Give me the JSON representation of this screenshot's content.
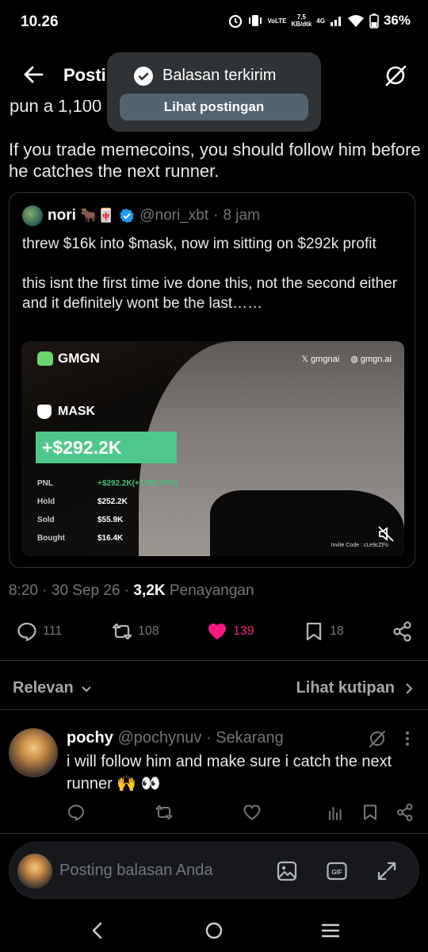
{
  "status_bar": {
    "time": "10.26",
    "volte": "VoLTE",
    "speed_value": "7,5",
    "speed_unit": "KB/dtk",
    "network": "4G",
    "battery": "36%"
  },
  "header": {
    "title": "Postingan"
  },
  "toast": {
    "message": "Balasan terkirim",
    "button_label": "Lihat postingan"
  },
  "main_tweet": {
    "text": "If you trade memecoins, you should follow him before he catches the next runner.",
    "partial_line": "pun a 1,100"
  },
  "quote": {
    "name": "nori",
    "emoji": "🐂🀄",
    "handle": "@nori_xbt",
    "time": "8 jam",
    "paragraph_1": "threw $16k into $mask, now im sitting on $292k profit",
    "paragraph_2": "this isnt the first time ive done this, not the second either and it definitely wont be the last……",
    "media": {
      "brand": "GMGN",
      "link_1": "gmgnai",
      "link_2": "gmgn.ai",
      "token": "MASK",
      "pnl_big": "+$292.2K",
      "stats": [
        {
          "label": "PNL",
          "value": "+$292.2K(+1782.47%)"
        },
        {
          "label": "Hold",
          "value": "$252.2K"
        },
        {
          "label": "Sold",
          "value": "$55.9K"
        },
        {
          "label": "Bought",
          "value": "$16.4K"
        }
      ],
      "invite": "Invite Code : cLe9cZFo"
    }
  },
  "meta": {
    "time": "8:20",
    "date": "30 Sep 26",
    "views_count": "3,2K",
    "views_label": "Penayangan"
  },
  "actions": {
    "replies": "111",
    "reposts": "108",
    "likes": "139",
    "bookmarks": "18"
  },
  "sort": {
    "label": "Relevan",
    "quotes_link": "Lihat kutipan"
  },
  "reply": {
    "name": "pochy",
    "handle": "@pochynuv",
    "time": "Sekarang",
    "text": "i will follow him and make sure i catch the next runner 🙌 👀"
  },
  "compose": {
    "placeholder": "Posting balasan Anda"
  },
  "colors": {
    "background": "#000000",
    "like": "#f91880",
    "verified": "#1d9bf0",
    "muted_text": "#71767b",
    "toast_bg": "#2f3336"
  }
}
